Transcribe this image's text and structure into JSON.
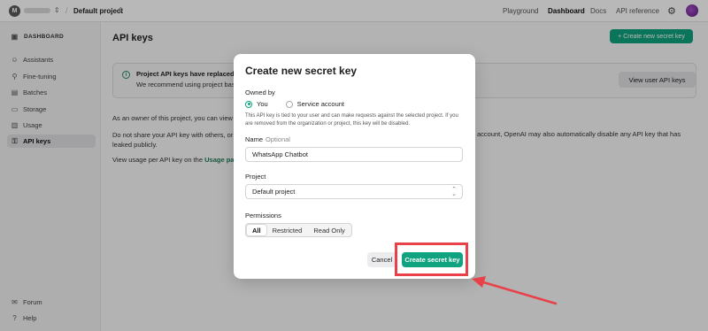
{
  "topbar": {
    "org_initial": "M",
    "project_name": "Default project",
    "nav": [
      "Playground",
      "Dashboard",
      "Docs",
      "API reference"
    ],
    "active_nav": "Dashboard"
  },
  "sidebar": {
    "section_title": "DASHBOARD",
    "items": [
      {
        "label": "Assistants",
        "icon": "assistant-icon"
      },
      {
        "label": "Fine-tuning",
        "icon": "fine-tuning-icon"
      },
      {
        "label": "Batches",
        "icon": "batches-icon"
      },
      {
        "label": "Storage",
        "icon": "storage-icon"
      },
      {
        "label": "Usage",
        "icon": "usage-icon"
      },
      {
        "label": "API keys",
        "icon": "key-icon",
        "active": true
      }
    ],
    "bottom": [
      {
        "label": "Forum",
        "icon": "forum-icon"
      },
      {
        "label": "Help",
        "icon": "help-icon"
      }
    ]
  },
  "main": {
    "title": "API keys",
    "create_button": "+ Create new secret key",
    "notice": {
      "title": "Project API keys have replaced us",
      "body": "We recommend using project base",
      "button": "View user API keys"
    },
    "para1": "As an owner of this project, you can view an",
    "para2_left": "Do not share your API key with others, or ex",
    "para2_right": "account, OpenAI may also automatically disable any API key that has",
    "para2_cont": "leaked publicly.",
    "para3_prefix": "View usage per API key on the",
    "para3_link": "Usage page"
  },
  "modal": {
    "title": "Create new secret key",
    "owned_by_label": "Owned by",
    "owner_options": [
      "You",
      "Service account"
    ],
    "owner_selected": "You",
    "help_text": "This API key is tied to your user and can make requests against the selected project. If you are removed from the organization or project, this key will be disabled.",
    "name_label": "Name",
    "name_optional": "Optional",
    "name_value": "WhatsApp Chatbot",
    "project_label": "Project",
    "project_value": "Default project",
    "permissions_label": "Permissions",
    "permissions": [
      "All",
      "Restricted",
      "Read Only"
    ],
    "permissions_selected": "All",
    "cancel": "Cancel",
    "create": "Create secret key"
  },
  "colors": {
    "accent": "#10a37f",
    "annotation": "#e8414a"
  }
}
